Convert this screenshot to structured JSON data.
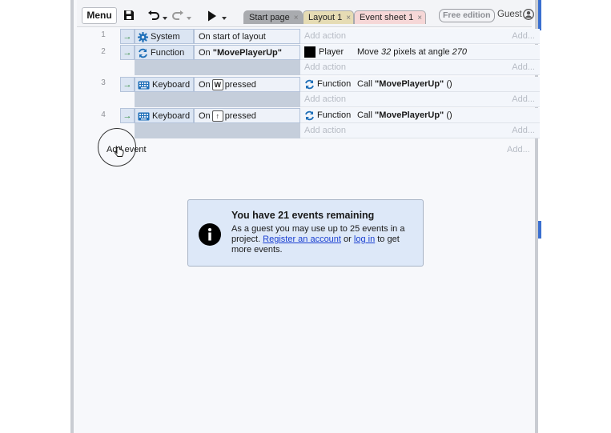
{
  "toolbar": {
    "menu_label": "Menu",
    "tabs": [
      {
        "label": "Start page",
        "close": "×"
      },
      {
        "label": "Layout 1",
        "close": "×"
      },
      {
        "label": "Event sheet 1",
        "close": "×"
      }
    ],
    "free_edition_label": "Free edition",
    "guest_label": "Guest"
  },
  "events": [
    {
      "number": "1",
      "object": "System",
      "object_icon": "gear-icon",
      "condition": "On start of layout",
      "actions": [],
      "add_action": "Add action",
      "add_more": "Add..."
    },
    {
      "number": "2",
      "object": "Function",
      "object_icon": "function-icon",
      "condition_prefix": "On ",
      "condition_bold": "\"MovePlayerUp\"",
      "actions": [
        {
          "object": "Player",
          "object_icon": "black-square-icon",
          "text_prefix": "Move ",
          "text_em1": "32",
          "text_mid": " pixels at angle ",
          "text_em2": "270"
        }
      ],
      "add_action": "Add action",
      "add_more": "Add..."
    },
    {
      "number": "3",
      "object": "Keyboard",
      "object_icon": "keyboard-icon",
      "condition_prefix": "On",
      "condition_key": "W",
      "condition_suffix": "pressed",
      "actions": [
        {
          "object": "Function",
          "object_icon": "function-icon",
          "text_prefix": "Call ",
          "text_bold": "\"MovePlayerUp\"",
          "text_suffix": " ()"
        }
      ],
      "add_action": "Add action",
      "add_more": "Add..."
    },
    {
      "number": "4",
      "object": "Keyboard",
      "object_icon": "keyboard-icon",
      "condition_prefix": "On",
      "condition_key": "↑",
      "condition_suffix": "pressed",
      "actions": [
        {
          "object": "Function",
          "object_icon": "function-icon",
          "text_prefix": "Call ",
          "text_bold": "\"MovePlayerUp\"",
          "text_suffix": " ()"
        }
      ],
      "add_action": "Add action",
      "add_more": "Add..."
    }
  ],
  "add_event": {
    "label": "Add event",
    "more": "Add..."
  },
  "notice": {
    "title": "You have 21 events remaining",
    "text1": "As a guest you may use up to 25 events in a project. ",
    "link_register": "Register an account",
    "text2": " or ",
    "link_login": "log in",
    "text3": " to get more events."
  },
  "colors": {
    "accent": "#3a6fd0",
    "condition_bg": "#dbe5f3",
    "action_bg": "#f3f6fb",
    "arrow_green": "#2d8a3a",
    "notice_bg": "#dde8f8"
  }
}
